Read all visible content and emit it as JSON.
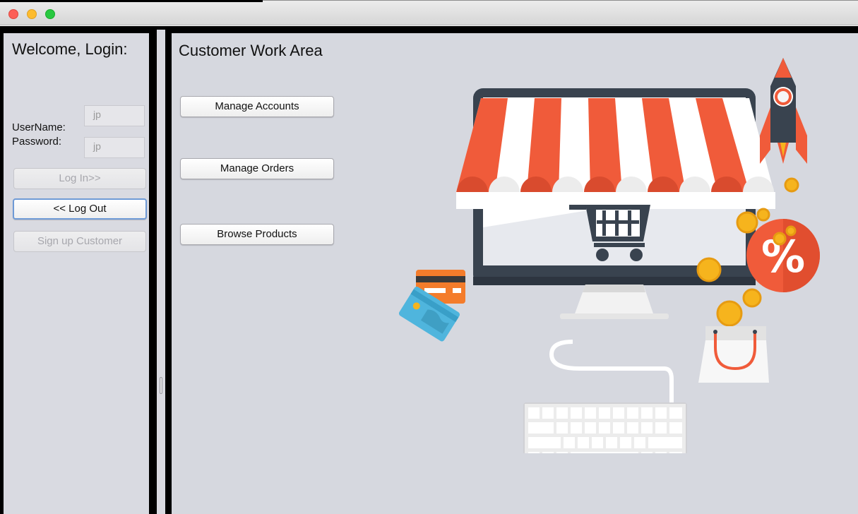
{
  "window": {
    "controls": [
      "close",
      "minimize",
      "zoom"
    ]
  },
  "login_panel": {
    "heading": "Welcome, Login:",
    "username_label": "UserName:",
    "username_value": "jp",
    "password_label": "Password:",
    "password_value": "jp",
    "login_button": "Log In>>",
    "logout_button": "<< Log Out",
    "signup_button": "Sign up Customer"
  },
  "work_area": {
    "title": "Customer Work Area",
    "buttons": {
      "manage_accounts": "Manage Accounts",
      "manage_orders": "Manage Orders",
      "browse_products": "Browse Products"
    },
    "illustration": {
      "icons": [
        "monitor-icon",
        "shop-awning-icon",
        "shopping-cart-icon",
        "rocket-icon",
        "percent-badge-icon",
        "credit-card-icon",
        "shopping-bag-icon",
        "coin-icon",
        "keyboard-icon"
      ],
      "percent_text": "%",
      "coin_symbol": "$"
    }
  },
  "colors": {
    "panel_background": "#d8d9e0",
    "awning_red": "#f05b3a",
    "monitor_dark": "#39434f",
    "coin_gold": "#f6b41d",
    "divider_black": "#000000"
  }
}
